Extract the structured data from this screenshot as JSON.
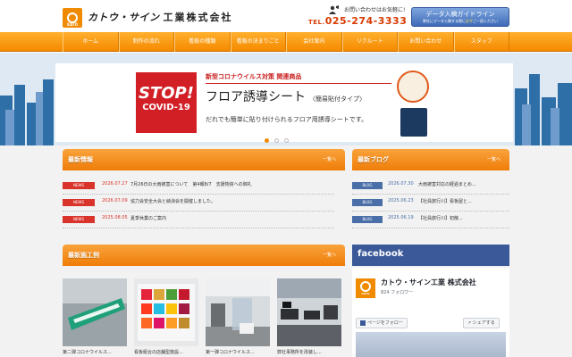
{
  "header": {
    "logo_small": "KATO",
    "logo_name": "カトウ・サイン",
    "logo_suffix": "工業株式会社",
    "contact_label": "お問い合わせはお気軽に!",
    "tel_prefix": "TEL.",
    "tel_number": "025-274-3333",
    "guide_button": {
      "line1": "データ入稿ガイドライン",
      "line2_a": "弊社にデータ入稿する際に",
      "line2_b": "必ず",
      "line2_c": "ご一読ください"
    }
  },
  "nav": {
    "items": [
      "ホーム",
      "制作の流れ",
      "看板の種類",
      "看板の決まりごと",
      "会社案内",
      "リクルート",
      "お問い合わせ",
      "スタッフ"
    ]
  },
  "hero": {
    "stop_label": "STOP!",
    "covid_label": "COVID-19",
    "kicker": "新型コロナウイルス対策 関連商品",
    "headline": "フロア誘導シート",
    "headline_sub": "〈簡易貼付タイプ〉",
    "description": "だれでも簡単に貼り付けられるフロア用誘導シートです。",
    "slides": 3,
    "active_slide": 0
  },
  "news": {
    "title": "最新情報",
    "more": "一覧へ",
    "badge": "NEWS",
    "items": [
      {
        "date": "2026.07.27",
        "title": "7月26日の大雨被害について　第4報8/7　支援物資への御礼"
      },
      {
        "date": "2026.07.09",
        "title": "協力会安全大会と納涼会を開催しました。"
      },
      {
        "date": "2025.08.05",
        "title": "夏季休業のご案内"
      }
    ]
  },
  "blog": {
    "title": "最新ブログ",
    "more": "一覧へ",
    "badge": "BLOG",
    "items": [
      {
        "date": "2026.07.30",
        "title": "大雨被害対応の経過まとめ..."
      },
      {
        "date": "2025.06.23",
        "title": "【社員旅行川】看板屋と..."
      },
      {
        "date": "2025.06.19",
        "title": "【社員旅行川】初散..."
      }
    ]
  },
  "works": {
    "title": "最新施工例",
    "more": "一覧へ",
    "items": [
      {
        "caption": "第二弾コロナウイルス..."
      },
      {
        "caption": "看板組合の店舗型施設..."
      },
      {
        "caption": "第一弾コロナウイルス..."
      },
      {
        "caption": "弊社事務所を改装し..."
      }
    ]
  },
  "facebook": {
    "header": "facebook",
    "page_name": "カトウ・サイン工業 株式会社",
    "followers": "824 フォロワー",
    "like_label": "ページをフォロー",
    "share_label": "シェアする"
  },
  "colors": {
    "brand_orange": "#f58a00",
    "news_red": "#d9342b",
    "blog_blue": "#4a6fa8",
    "facebook_blue": "#3b5998"
  }
}
